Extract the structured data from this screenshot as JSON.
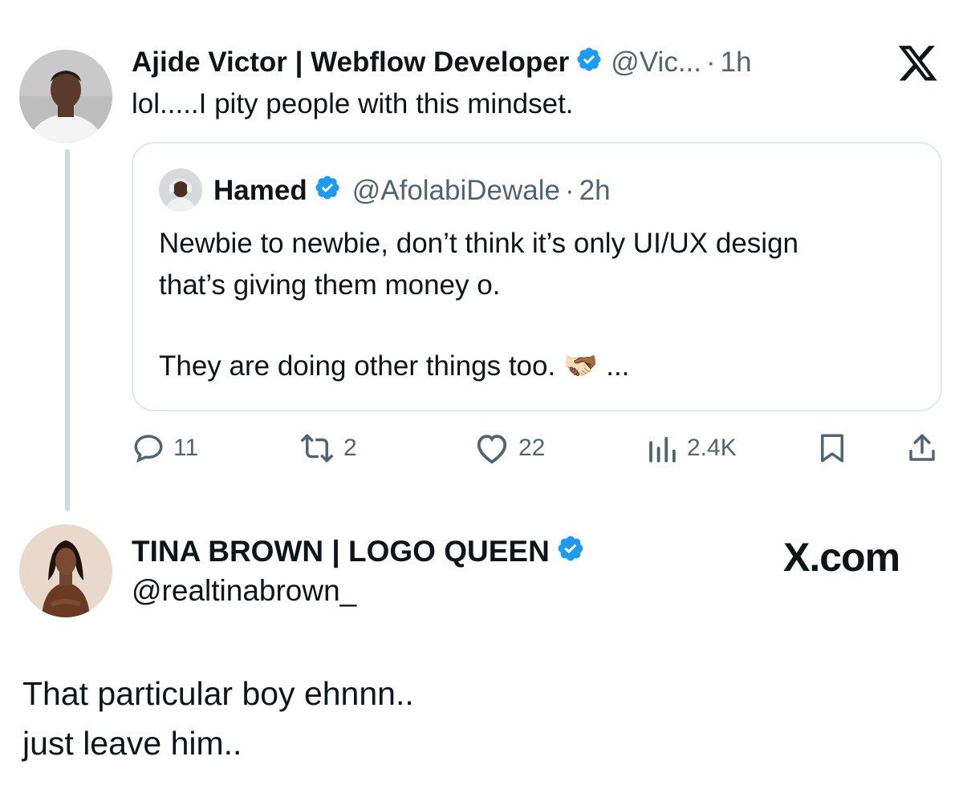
{
  "reply": {
    "display_name": "Ajide Victor | Webflow Developer",
    "handle": "@Vic...",
    "separator": "·",
    "time": "1h",
    "text": "lol.....I pity people with this mindset.",
    "avatar_icon": "user-avatar-icon"
  },
  "quote": {
    "display_name": "Hamed",
    "handle": "@AfolabiDewale",
    "separator": "·",
    "time": "2h",
    "line1": "Newbie to newbie, don’t think it’s only UI/UX design",
    "line2": "that’s giving them money o.",
    "line3": "They are doing other things too. 🫱🏻‍🫲🏾 ...",
    "avatar_icon": "user-avatar-icon"
  },
  "actions": {
    "replies": "11",
    "reposts": "2",
    "likes": "22",
    "views": "2.4K"
  },
  "original": {
    "display_name": "TINA BROWN | LOGO QUEEN",
    "handle": "@realtinabrown_",
    "line1": "That particular boy ehnnn..",
    "line2": "just leave him..",
    "avatar_icon": "user-avatar-icon"
  },
  "branding": {
    "x_logo_icon": "x-logo-icon",
    "site_label": "X.com"
  },
  "colors": {
    "verified_blue": "#1d9bf0",
    "secondary_text": "#536471",
    "primary_text": "#0f1419",
    "card_border": "#e1e8ed"
  }
}
